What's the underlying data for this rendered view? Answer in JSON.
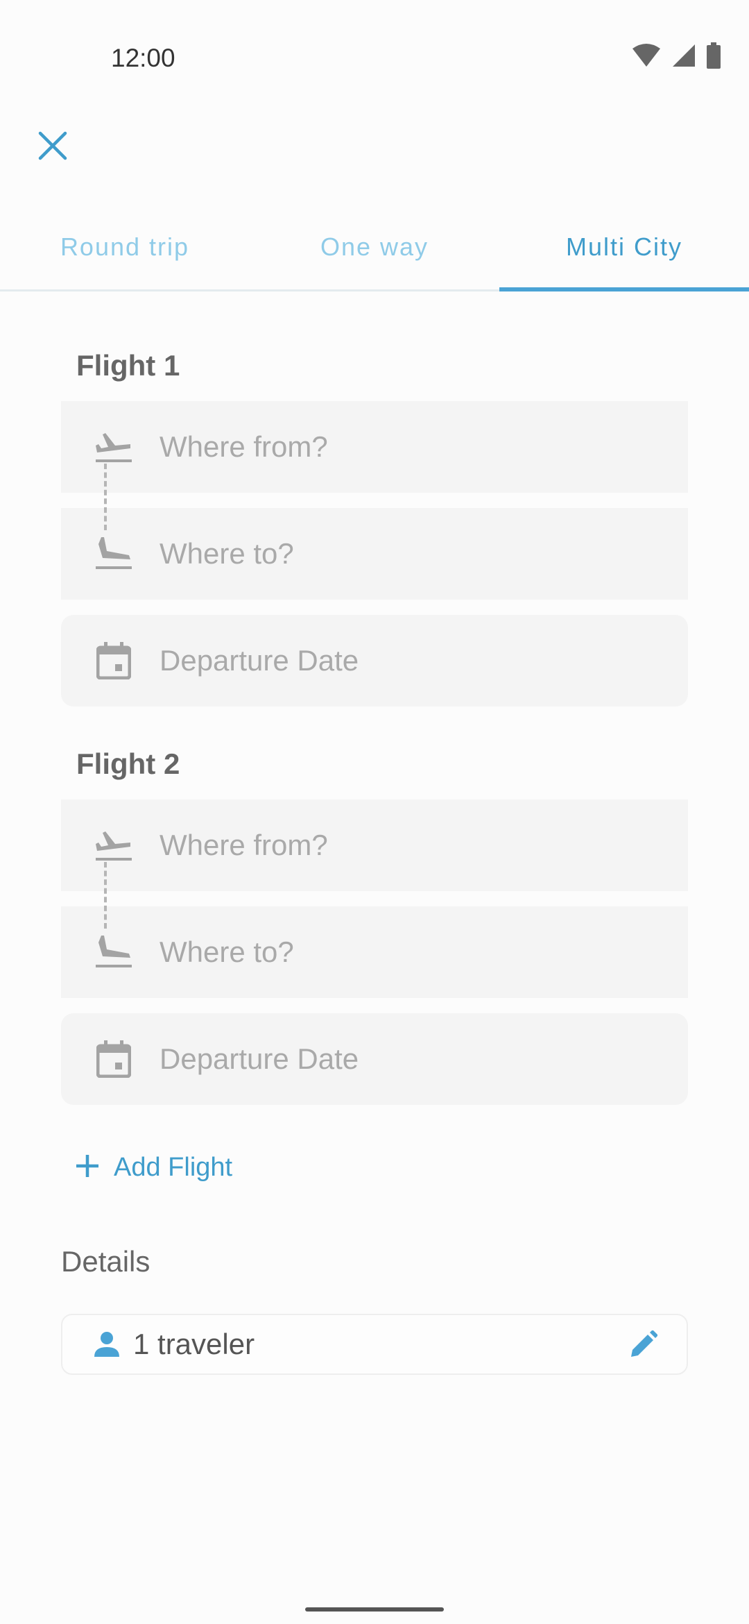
{
  "status_bar": {
    "time": "12:00"
  },
  "icons": {
    "close": "close-icon",
    "wifi": "wifi-icon",
    "signal": "signal-icon",
    "battery": "battery-icon",
    "takeoff": "flight-takeoff-icon",
    "landing": "flight-land-icon",
    "calendar": "calendar-icon",
    "plus": "plus-icon",
    "person": "person-icon",
    "edit": "pencil-icon"
  },
  "colors": {
    "accent": "#4aa3d5",
    "accent_text": "#3f9ccb",
    "inactive_tab": "#8fcbe8",
    "field_bg": "#f4f4f4",
    "placeholder": "#a9a9a9"
  },
  "tabs": [
    {
      "label": "Round trip",
      "active": false
    },
    {
      "label": "One way",
      "active": false
    },
    {
      "label": "Multi City",
      "active": true
    }
  ],
  "flights": [
    {
      "title": "Flight 1",
      "from_placeholder": "Where from?",
      "to_placeholder": "Where to?",
      "date_placeholder": "Departure Date"
    },
    {
      "title": "Flight 2",
      "from_placeholder": "Where from?",
      "to_placeholder": "Where to?",
      "date_placeholder": "Departure Date"
    }
  ],
  "add_flight_label": "Add Flight",
  "details": {
    "title": "Details",
    "traveler_label": "1 traveler"
  }
}
